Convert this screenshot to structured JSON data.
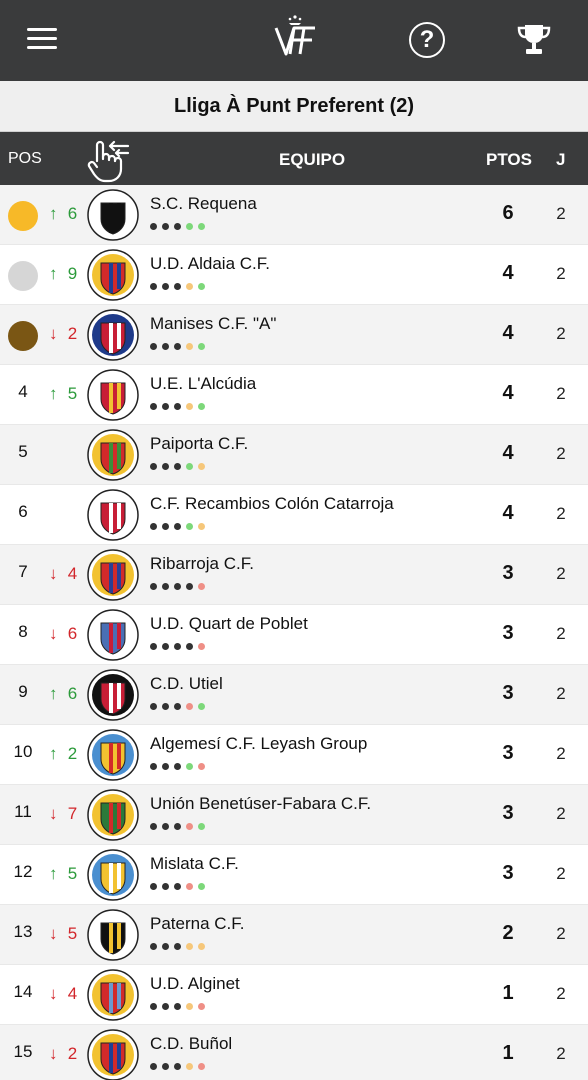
{
  "header": {
    "menu_icon": "hamburger-menu-icon",
    "logo_text": "VFF",
    "help_icon": "help-circle-icon",
    "help_glyph": "?",
    "trophy_icon": "trophy-icon",
    "league_title": "Lliga À Punt Preferent (2)"
  },
  "columns": {
    "pos": "POS",
    "swipe_icon": "swipe-hand-icon",
    "team": "EQUIPO",
    "points": "PTOS",
    "played": "J"
  },
  "colors": {
    "dark_bar": "#3a3b3c",
    "gold": "#f7b928",
    "silver": "#d6d6d6",
    "bronze": "#7a5614",
    "up": "#2b9a3a",
    "down": "#d2262b",
    "form_played": "#333333",
    "form_win": "#7dd87a",
    "form_draw": "#f6c77a",
    "form_loss": "#ef8f86"
  },
  "rows": [
    {
      "pos": "",
      "medal": "gold",
      "dir": "up",
      "change": "6",
      "team": "S.C. Requena",
      "crest": "sc-requena-crest",
      "form": [
        "p",
        "p",
        "p",
        "w",
        "w"
      ],
      "pts": "6",
      "j": "2"
    },
    {
      "pos": "",
      "medal": "silver",
      "dir": "up",
      "change": "9",
      "team": "U.D. Aldaia C.F.",
      "crest": "ud-aldaia-crest",
      "form": [
        "p",
        "p",
        "p",
        "d",
        "w"
      ],
      "pts": "4",
      "j": "2"
    },
    {
      "pos": "",
      "medal": "bronze",
      "dir": "down",
      "change": "2",
      "team": "Manises C.F. \"A\"",
      "crest": "manises-cf-crest",
      "form": [
        "p",
        "p",
        "p",
        "d",
        "w"
      ],
      "pts": "4",
      "j": "2"
    },
    {
      "pos": "4",
      "medal": "",
      "dir": "up",
      "change": "5",
      "team": "U.E. L'Alcúdia",
      "crest": "ue-lalcudia-crest",
      "form": [
        "p",
        "p",
        "p",
        "d",
        "w"
      ],
      "pts": "4",
      "j": "2"
    },
    {
      "pos": "5",
      "medal": "",
      "dir": "",
      "change": "",
      "team": "Paiporta C.F.",
      "crest": "paiporta-cf-crest",
      "form": [
        "p",
        "p",
        "p",
        "w",
        "d"
      ],
      "pts": "4",
      "j": "2"
    },
    {
      "pos": "6",
      "medal": "",
      "dir": "",
      "change": "",
      "team": "C.F. Recambios Colón Catarroja",
      "crest": "cf-recambios-colon-crest",
      "form": [
        "p",
        "p",
        "p",
        "w",
        "d"
      ],
      "pts": "4",
      "j": "2"
    },
    {
      "pos": "7",
      "medal": "",
      "dir": "down",
      "change": "4",
      "team": "Ribarroja C.F.",
      "crest": "ribarroja-cf-crest",
      "form": [
        "p",
        "p",
        "p",
        "p",
        "l"
      ],
      "pts": "3",
      "j": "2"
    },
    {
      "pos": "8",
      "medal": "",
      "dir": "down",
      "change": "6",
      "team": "U.D. Quart de Poblet",
      "crest": "ud-quart-de-poblet-crest",
      "form": [
        "p",
        "p",
        "p",
        "p",
        "l"
      ],
      "pts": "3",
      "j": "2"
    },
    {
      "pos": "9",
      "medal": "",
      "dir": "up",
      "change": "6",
      "team": "C.D. Utiel",
      "crest": "cd-utiel-crest",
      "form": [
        "p",
        "p",
        "p",
        "l",
        "w"
      ],
      "pts": "3",
      "j": "2"
    },
    {
      "pos": "10",
      "medal": "",
      "dir": "up",
      "change": "2",
      "team": "Algemesí C.F. Leyash Group",
      "crest": "algemesi-cf-crest",
      "form": [
        "p",
        "p",
        "p",
        "w",
        "l"
      ],
      "pts": "3",
      "j": "2"
    },
    {
      "pos": "11",
      "medal": "",
      "dir": "down",
      "change": "7",
      "team": "Unión Benetúser-Fabara C.F.",
      "crest": "union-benetuser-fabara-crest",
      "form": [
        "p",
        "p",
        "p",
        "l",
        "w"
      ],
      "pts": "3",
      "j": "2"
    },
    {
      "pos": "12",
      "medal": "",
      "dir": "up",
      "change": "5",
      "team": "Mislata C.F.",
      "crest": "mislata-cf-crest",
      "form": [
        "p",
        "p",
        "p",
        "l",
        "w"
      ],
      "pts": "3",
      "j": "2"
    },
    {
      "pos": "13",
      "medal": "",
      "dir": "down",
      "change": "5",
      "team": "Paterna C.F.",
      "crest": "paterna-cf-crest",
      "form": [
        "p",
        "p",
        "p",
        "d",
        "d"
      ],
      "pts": "2",
      "j": "2"
    },
    {
      "pos": "14",
      "medal": "",
      "dir": "down",
      "change": "4",
      "team": "U.D. Alginet",
      "crest": "ud-alginet-crest",
      "form": [
        "p",
        "p",
        "p",
        "d",
        "l"
      ],
      "pts": "1",
      "j": "2"
    },
    {
      "pos": "15",
      "medal": "",
      "dir": "down",
      "change": "2",
      "team": "C.D. Buñol",
      "crest": "cd-bunol-crest",
      "form": [
        "p",
        "p",
        "p",
        "d",
        "l"
      ],
      "pts": "1",
      "j": "2"
    }
  ]
}
